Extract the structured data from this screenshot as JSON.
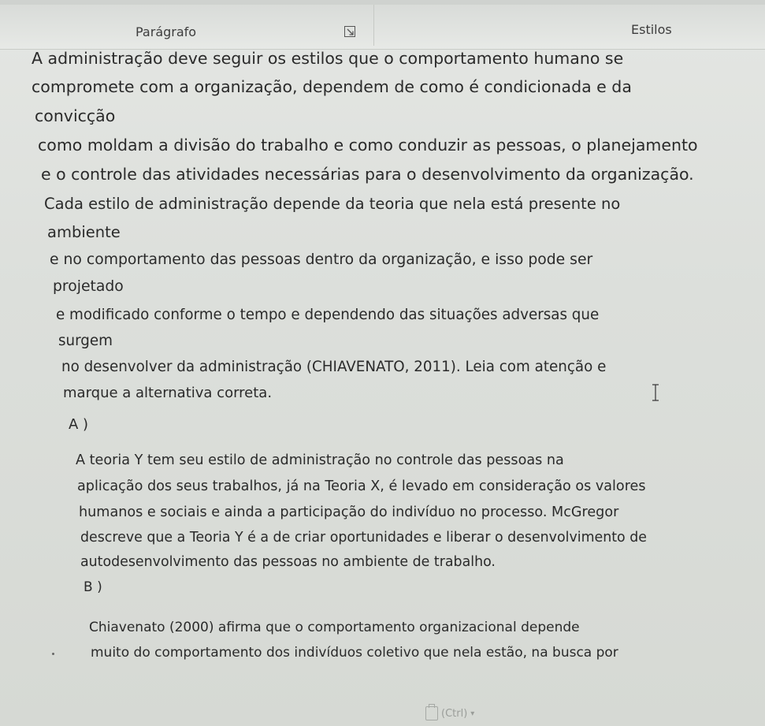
{
  "ribbon": {
    "paragraph_label": "Parágrafo",
    "styles_label": "Estilos"
  },
  "question": {
    "lines": [
      "A administração deve seguir os estilos que o comportamento humano se",
      "compromete com a organização, dependem de como é condicionada e da",
      "convicção",
      "como moldam a divisão do trabalho e como conduzir as pessoas, o planejamento",
      "e o controle das atividades necessárias para o desenvolvimento da organização.",
      "Cada estilo de administração depende da teoria que nela está presente no",
      "ambiente",
      "e no comportamento das pessoas dentro da organização, e isso pode ser",
      "projetado",
      "e modificado conforme o tempo e dependendo das situações adversas que",
      "surgem",
      "no desenvolver da administração (CHIAVENATO, 2011). Leia com atenção e",
      "marque a alternativa correta."
    ]
  },
  "options": [
    {
      "label": "A )",
      "lines": [
        "A teoria Y tem seu estilo de administração no controle das pessoas na",
        "aplicação dos seus trabalhos, já na Teoria X, é levado em consideração os valores",
        "humanos e sociais e ainda a participação do indivíduo no processo. McGregor",
        "descreve que a Teoria Y é a de criar oportunidades e liberar o desenvolvimento de",
        "autodesenvolvimento das pessoas no ambiente de trabalho."
      ]
    },
    {
      "label": "B )",
      "lines": [
        "Chiavenato (2000) afirma que o comportamento organizacional depende",
        "muito do comportamento dos indivíduos coletivo que nela estão, na busca por"
      ]
    }
  ],
  "paste_options": {
    "label": "(Ctrl)",
    "icon": "clipboard-icon"
  },
  "colors": {
    "text": "#2a2a2a",
    "ribbon_bg": "#e7e9e6",
    "page_bg": "#dcdfdb"
  }
}
